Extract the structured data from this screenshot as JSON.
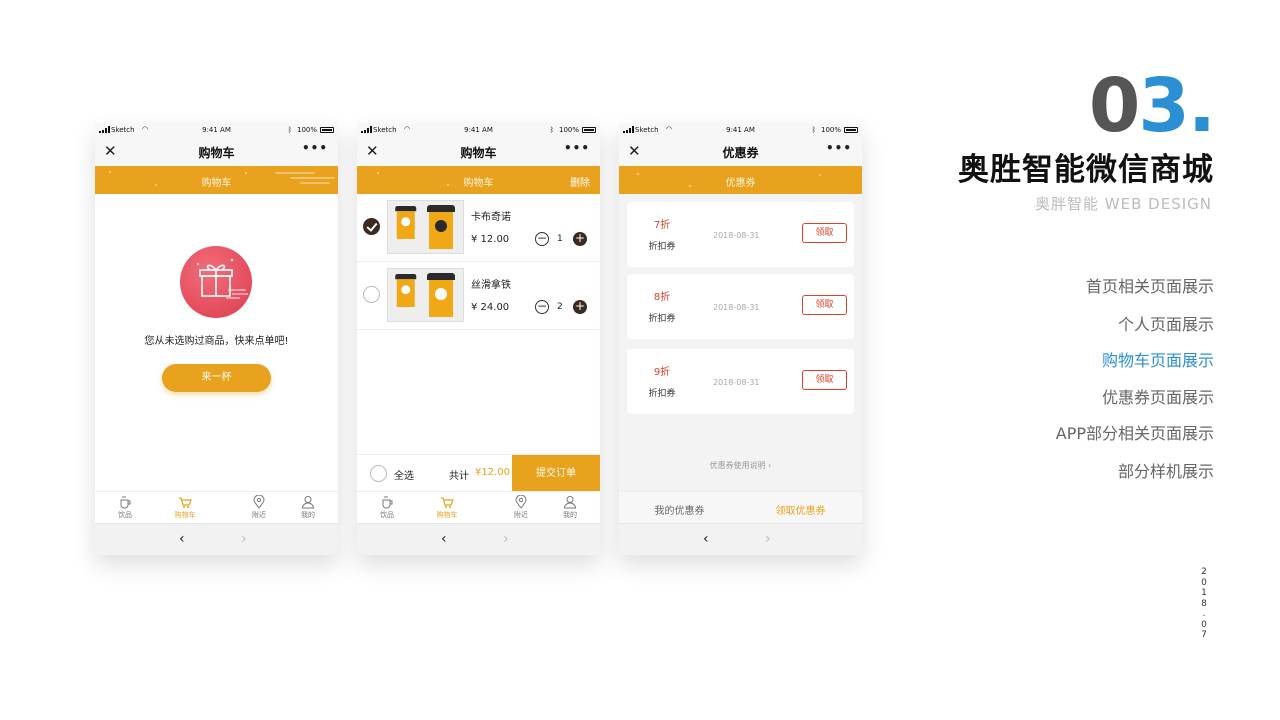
{
  "colors": {
    "accent": "#e8a21d",
    "blue": "#2b8fd4",
    "coupon_red": "#d9412b"
  },
  "status_bar": {
    "carrier": "Sketch",
    "time": "9:41 AM",
    "battery": "100%"
  },
  "phone1": {
    "nav_title": "购物车",
    "banner_title": "购物车",
    "empty_text": "您从未选购过商品，快来点单吧!",
    "cta_label": "来一杯",
    "tabs": [
      "饮品",
      "购物车",
      "附近",
      "我的"
    ]
  },
  "phone2": {
    "nav_title": "购物车",
    "banner_title": "购物车",
    "delete_label": "删除",
    "items": [
      {
        "name": "卡布奇诺",
        "price": "¥ 12.00",
        "qty": "1",
        "checked": true
      },
      {
        "name": "丝滑拿铁",
        "price": "¥ 24.00",
        "qty": "2",
        "checked": false
      }
    ],
    "select_all_label": "全选",
    "total_label": "共计",
    "total_value": "¥12.00",
    "submit_label": "提交订单",
    "tabs": [
      "饮品",
      "购物车",
      "附近",
      "我的"
    ]
  },
  "phone3": {
    "nav_title": "优惠券",
    "banner_title": "优惠券",
    "coupons": [
      {
        "discount": "7折",
        "type": "折扣券",
        "date": "2018-08-31",
        "action": "领取"
      },
      {
        "discount": "8折",
        "type": "折扣券",
        "date": "2018-08-31",
        "action": "领取"
      },
      {
        "discount": "9折",
        "type": "折扣券",
        "date": "2018-08-31",
        "action": "领取"
      }
    ],
    "help_label": "优惠券使用说明",
    "tab_mine": "我的优惠券",
    "tab_get": "领取优惠券"
  },
  "side": {
    "number_0": "0",
    "number_3": "3",
    "number_dot": ".",
    "title": "奥胜智能微信商城",
    "subtitle": "奥胖智能 WEB DESIGN",
    "menu": [
      "首页相关页面展示",
      "个人页面展示",
      "购物车页面展示",
      "优惠券页面展示",
      "APP部分相关页面展示",
      "部分样机展示"
    ],
    "active_menu_index": 2,
    "date_chars": [
      "2",
      "0",
      "1",
      "8",
      ".",
      "0",
      "7"
    ]
  },
  "icons": [
    "close-icon",
    "more-icon",
    "gift-icon",
    "cup-icon",
    "cart-icon",
    "location-icon",
    "user-icon",
    "back-icon",
    "forward-icon",
    "wifi-icon",
    "bluetooth-icon",
    "battery-icon",
    "checkmark-icon",
    "minus-icon",
    "plus-icon"
  ]
}
